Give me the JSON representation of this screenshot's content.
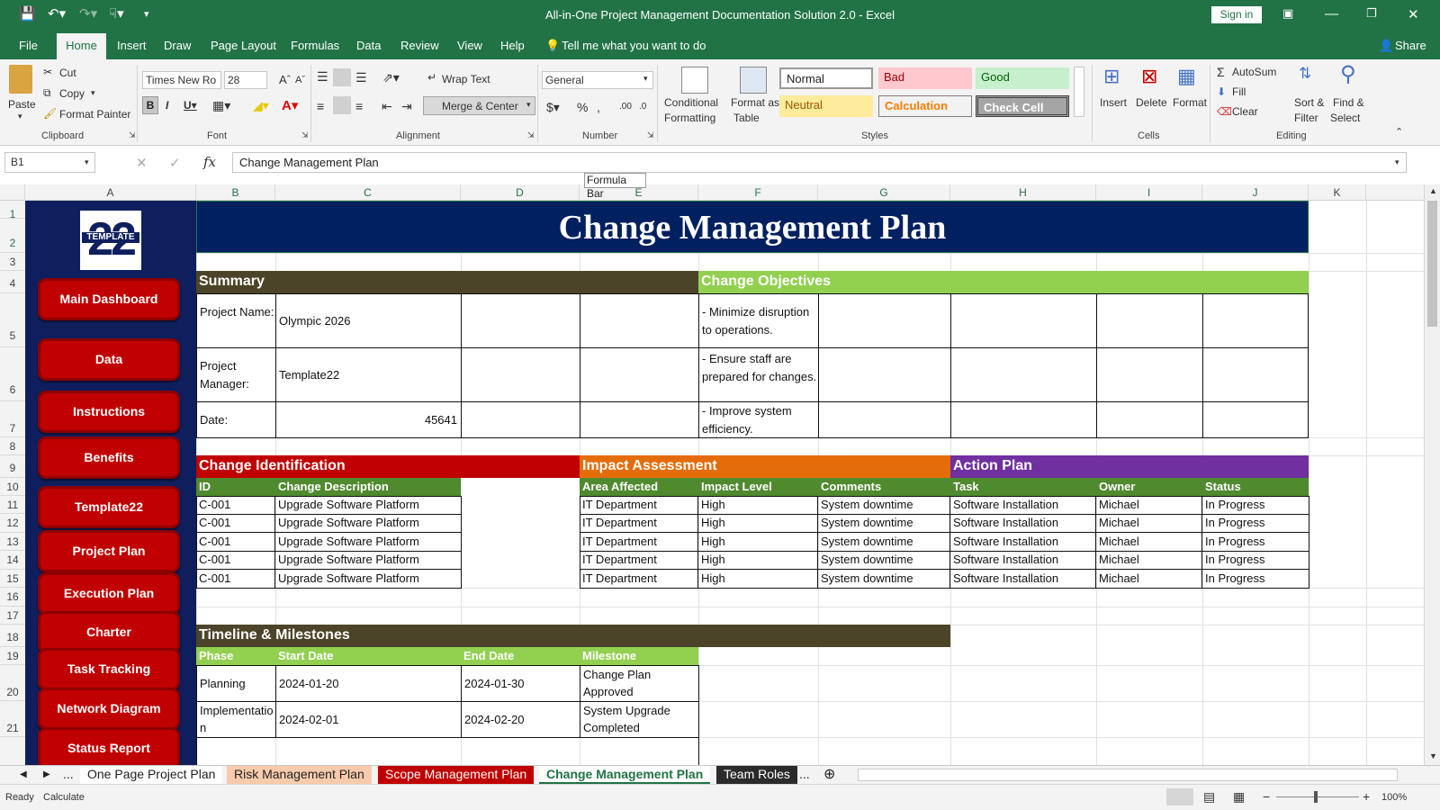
{
  "window": {
    "title": "All-in-One Project Management Documentation Solution 2.0  -  Excel",
    "sign_in": "Sign in"
  },
  "menu": [
    "File",
    "Home",
    "Insert",
    "Draw",
    "Page Layout",
    "Formulas",
    "Data",
    "Review",
    "View",
    "Help"
  ],
  "tell_me": "Tell me what you want to do",
  "share": "Share",
  "clipboard": {
    "paste": "Paste",
    "cut": "Cut",
    "copy": "Copy",
    "format_painter": "Format Painter",
    "group": "Clipboard"
  },
  "font": {
    "name": "Times New Ro",
    "size": "28",
    "group": "Font"
  },
  "alignment": {
    "wrap": "Wrap Text",
    "merge": "Merge & Center",
    "group": "Alignment"
  },
  "number": {
    "format": "General",
    "group": "Number"
  },
  "styles": {
    "conditional": "Conditional",
    "formatting": "Formatting",
    "format_as": "Format as",
    "table": "Table",
    "normal": "Normal",
    "bad": "Bad",
    "good": "Good",
    "neutral": "Neutral",
    "calculation": "Calculation",
    "check_cell": "Check Cell",
    "group": "Styles"
  },
  "cells": {
    "insert": "Insert",
    "delete": "Delete",
    "format": "Format",
    "group": "Cells"
  },
  "editing": {
    "autosum": "AutoSum",
    "fill": "Fill",
    "clear": "Clear",
    "sort": "Sort &",
    "filter": "Filter",
    "find": "Find &",
    "select": "Select",
    "group": "Editing"
  },
  "formula_bar": {
    "name_box": "B1",
    "content": "Change Management Plan",
    "tooltip": "Formula Bar"
  },
  "columns": [
    "A",
    "B",
    "C",
    "D",
    "E",
    "F",
    "G",
    "H",
    "I",
    "J",
    "K"
  ],
  "rows": [
    "1",
    "2",
    "3",
    "4",
    "5",
    "6",
    "7",
    "8",
    "9",
    "10",
    "11",
    "12",
    "13",
    "14",
    "15",
    "16",
    "17",
    "18",
    "19",
    "20",
    "21"
  ],
  "sidebar": {
    "logo_number": "22",
    "logo_text": "TEMPLATE",
    "buttons": [
      "Main Dashboard",
      "Data",
      "Instructions",
      "Benefits",
      "Template22",
      "Project Plan",
      "Execution Plan",
      "Charter",
      "Task Tracking",
      "Network Diagram",
      "Status Report"
    ]
  },
  "sheet": {
    "title": "Change Management Plan",
    "summary": {
      "header": "Summary",
      "project_name_label": "Project Name:",
      "project_name": "Olympic 2026",
      "manager_label": "Project Manager:",
      "manager": "Template22",
      "date_label": "Date:",
      "date": "45641"
    },
    "objectives": {
      "header": "Change Objectives",
      "items": [
        "- Minimize disruption to operations.",
        "- Ensure staff are prepared for changes.",
        "- Improve system efficiency."
      ]
    },
    "identification": {
      "header": "Change Identification",
      "cols": [
        "ID",
        "Change Description"
      ],
      "rows": [
        [
          "C-001",
          "Upgrade Software Platform"
        ],
        [
          "C-001",
          "Upgrade Software Platform"
        ],
        [
          "C-001",
          "Upgrade Software Platform"
        ],
        [
          "C-001",
          "Upgrade Software Platform"
        ],
        [
          "C-001",
          "Upgrade Software Platform"
        ]
      ]
    },
    "impact": {
      "header": "Impact Assessment",
      "cols": [
        "Area Affected",
        "Impact Level",
        "Comments"
      ],
      "rows": [
        [
          "IT Department",
          "High",
          "System downtime"
        ],
        [
          "IT Department",
          "High",
          "System downtime"
        ],
        [
          "IT Department",
          "High",
          "System downtime"
        ],
        [
          "IT Department",
          "High",
          "System downtime"
        ],
        [
          "IT Department",
          "High",
          "System downtime"
        ]
      ]
    },
    "action": {
      "header": "Action Plan",
      "cols": [
        "Task",
        "Owner",
        "Status"
      ],
      "rows": [
        [
          "Software Installation",
          "Michael",
          "In Progress"
        ],
        [
          "Software Installation",
          "Michael",
          "In Progress"
        ],
        [
          "Software Installation",
          "Michael",
          "In Progress"
        ],
        [
          "Software Installation",
          "Michael",
          "In Progress"
        ],
        [
          "Software Installation",
          "Michael",
          "In Progress"
        ]
      ]
    },
    "timeline": {
      "header": "Timeline & Milestones",
      "cols": [
        "Phase",
        "Start Date",
        "End Date",
        "Milestone"
      ],
      "rows": [
        [
          "Planning",
          "2024-01-20",
          "2024-01-30",
          "Change Plan Approved"
        ],
        [
          "Implementation",
          "2024-02-01",
          "2024-02-20",
          "System Upgrade Completed"
        ]
      ]
    }
  },
  "tabs": [
    "One Page Project Plan",
    "Risk Management Plan",
    "Scope Management Plan",
    "Change Management Plan",
    "Team Roles"
  ],
  "status": {
    "ready": "Ready",
    "calculate": "Calculate",
    "zoom": "100%"
  },
  "colors": {
    "excel_green": "#217346",
    "navy": "#0f1f5e",
    "header_olive": "#4b4428",
    "lime": "#92d050",
    "red": "#c00000",
    "orange": "#e46c0a",
    "purple": "#7030a0",
    "sub_green": "#508a2f"
  }
}
